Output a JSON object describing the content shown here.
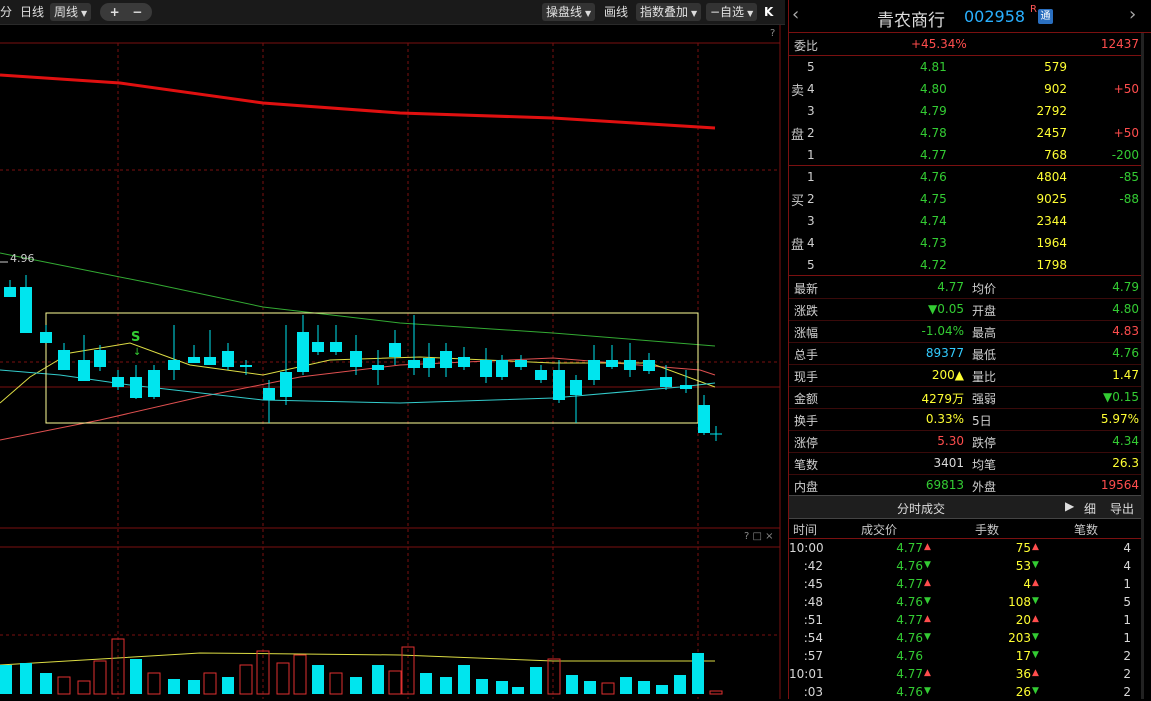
{
  "toolbar": {
    "fen": "分",
    "rixian": "日线",
    "zhouxian": "周线",
    "zoom_in": "+",
    "zoom_out": "−",
    "caopanxian": "操盘线",
    "huaxian": "画线",
    "zhibiao": "指数叠加",
    "zixuan": "−自选",
    "collapse": "K"
  },
  "chart": {
    "price_label": "4.96",
    "signal_label": "S",
    "help": "?",
    "volume_help": "? □ ×"
  },
  "quote": {
    "name": "青农商行",
    "code": "002958",
    "r_badge": "R",
    "tong_badge": "通",
    "weibi_label": "委比",
    "weibi_value": "+45.34%",
    "weicha_value": "12437",
    "sell_label_1": "卖",
    "sell_label_2": "盘",
    "buy_label_1": "买",
    "buy_label_2": "盘",
    "sell": [
      {
        "level": "5",
        "price": "4.81",
        "vol": "579",
        "chg": ""
      },
      {
        "level": "4",
        "price": "4.80",
        "vol": "902",
        "chg": "+50"
      },
      {
        "level": "3",
        "price": "4.79",
        "vol": "2792",
        "chg": ""
      },
      {
        "level": "2",
        "price": "4.78",
        "vol": "2457",
        "chg": "+50"
      },
      {
        "level": "1",
        "price": "4.77",
        "vol": "768",
        "chg": "-200"
      }
    ],
    "buy": [
      {
        "level": "1",
        "price": "4.76",
        "vol": "4804",
        "chg": "-85"
      },
      {
        "level": "2",
        "price": "4.75",
        "vol": "9025",
        "chg": "-88"
      },
      {
        "level": "3",
        "price": "4.74",
        "vol": "2344",
        "chg": ""
      },
      {
        "level": "4",
        "price": "4.73",
        "vol": "1964",
        "chg": ""
      },
      {
        "level": "5",
        "price": "4.72",
        "vol": "1798",
        "chg": ""
      }
    ],
    "stats": [
      {
        "l1": "最新",
        "v1": "4.77",
        "c1": "green",
        "l2": "均价",
        "v2": "4.79",
        "c2": "green"
      },
      {
        "l1": "涨跌",
        "v1": "▼0.05",
        "c1": "green",
        "l2": "开盘",
        "v2": "4.80",
        "c2": "green"
      },
      {
        "l1": "涨幅",
        "v1": "-1.04%",
        "c1": "green",
        "l2": "最高",
        "v2": "4.83",
        "c2": "red"
      },
      {
        "l1": "总手",
        "v1": "89377",
        "c1": "cyan",
        "l2": "最低",
        "v2": "4.76",
        "c2": "green"
      },
      {
        "l1": "现手",
        "v1": "200▲",
        "c1": "yellow",
        "l2": "量比",
        "v2": "1.47",
        "c2": "yellow"
      },
      {
        "l1": "金额",
        "v1": "4279万",
        "c1": "yellow",
        "l2": "强弱",
        "v2": "▼0.15",
        "c2": "green"
      },
      {
        "l1": "换手",
        "v1": "0.33%",
        "c1": "yellow",
        "l2": "5日",
        "v2": "5.97%",
        "c2": "yellow"
      },
      {
        "l1": "涨停",
        "v1": "5.30",
        "c1": "red",
        "l2": "跌停",
        "v2": "4.34",
        "c2": "green"
      },
      {
        "l1": "笔数",
        "v1": "3401",
        "c1": "white",
        "l2": "均笔",
        "v2": "26.3",
        "c2": "yellow"
      },
      {
        "l1": "内盘",
        "v1": "69813",
        "c1": "green",
        "l2": "外盘",
        "v2": "19564",
        "c2": "red"
      }
    ],
    "trade_tab": "分时成交",
    "xi_button": "细",
    "export_button": "导出",
    "tick_headers": [
      "时间",
      "成交价",
      "手数",
      "笔数"
    ],
    "ticks": [
      {
        "time": "10:00",
        "price": "4.77",
        "pc": "green",
        "pa": "▲",
        "pac": "red",
        "vol": "75",
        "vc": "yellow",
        "va": "▲",
        "vac": "red",
        "n": "4"
      },
      {
        "time": ":42",
        "price": "4.76",
        "pc": "green",
        "pa": "▼",
        "pac": "green",
        "vol": "53",
        "vc": "yellow",
        "va": "▼",
        "vac": "green",
        "n": "4"
      },
      {
        "time": ":45",
        "price": "4.77",
        "pc": "green",
        "pa": "▲",
        "pac": "red",
        "vol": "4",
        "vc": "yellow",
        "va": "▲",
        "vac": "red",
        "n": "1"
      },
      {
        "time": ":48",
        "price": "4.76",
        "pc": "green",
        "pa": "▼",
        "pac": "green",
        "vol": "108",
        "vc": "yellow",
        "va": "▼",
        "vac": "green",
        "n": "5"
      },
      {
        "time": ":51",
        "price": "4.77",
        "pc": "green",
        "pa": "▲",
        "pac": "red",
        "vol": "20",
        "vc": "yellow",
        "va": "▲",
        "vac": "red",
        "n": "1"
      },
      {
        "time": ":54",
        "price": "4.76",
        "pc": "green",
        "pa": "▼",
        "pac": "green",
        "vol": "203",
        "vc": "yellow",
        "va": "▼",
        "vac": "green",
        "n": "1"
      },
      {
        "time": ":57",
        "price": "4.76",
        "pc": "green",
        "pa": "",
        "pac": "green",
        "vol": "17",
        "vc": "yellow",
        "va": "▼",
        "vac": "green",
        "n": "2"
      },
      {
        "time": "10:01",
        "price": "4.77",
        "pc": "green",
        "pa": "▲",
        "pac": "red",
        "vol": "36",
        "vc": "yellow",
        "va": "▲",
        "vac": "red",
        "n": "2"
      },
      {
        "time": ":03",
        "price": "4.76",
        "pc": "green",
        "pa": "▼",
        "pac": "green",
        "vol": "26",
        "vc": "yellow",
        "va": "▼",
        "vac": "green",
        "n": "2"
      }
    ]
  }
}
